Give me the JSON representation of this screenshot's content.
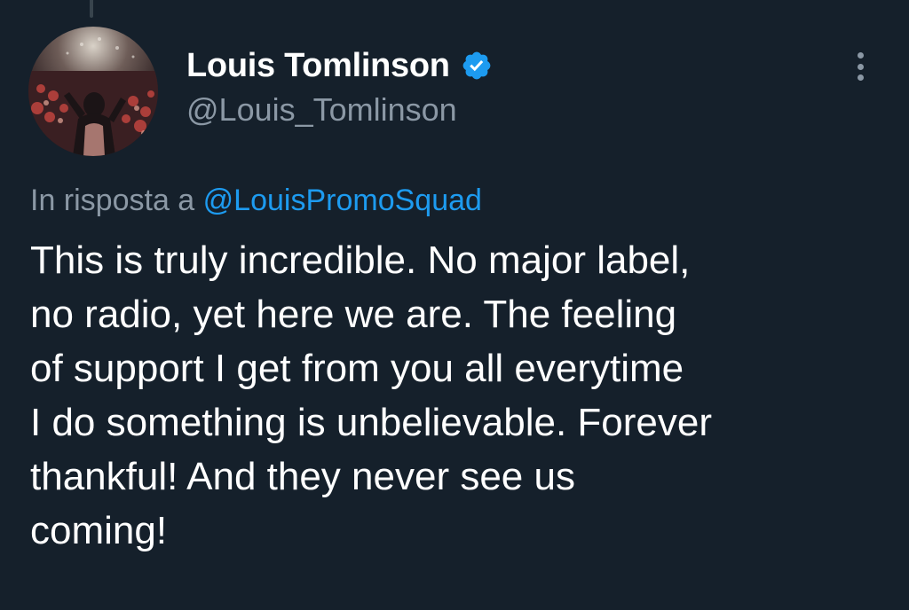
{
  "author": {
    "display_name": "Louis Tomlinson",
    "handle": "@Louis_Tomlinson",
    "verified": true,
    "verified_color": "#1d9bf0"
  },
  "reply": {
    "prefix": "In risposta a",
    "mention": "@LouisPromoSquad"
  },
  "tweet": {
    "lines": [
      "This is truly incredible. No major label,",
      "no radio, yet here we are. The feeling",
      "of support I get from you all everytime",
      "I do something is unbelievable. Forever",
      "thankful! And they never see us",
      "coming!"
    ]
  },
  "icons": {
    "verified": "verified-badge-icon",
    "more": "more-options-icon"
  },
  "colors": {
    "background": "#15202b",
    "secondary_text": "#8b98a5",
    "link": "#1d9bf0"
  }
}
